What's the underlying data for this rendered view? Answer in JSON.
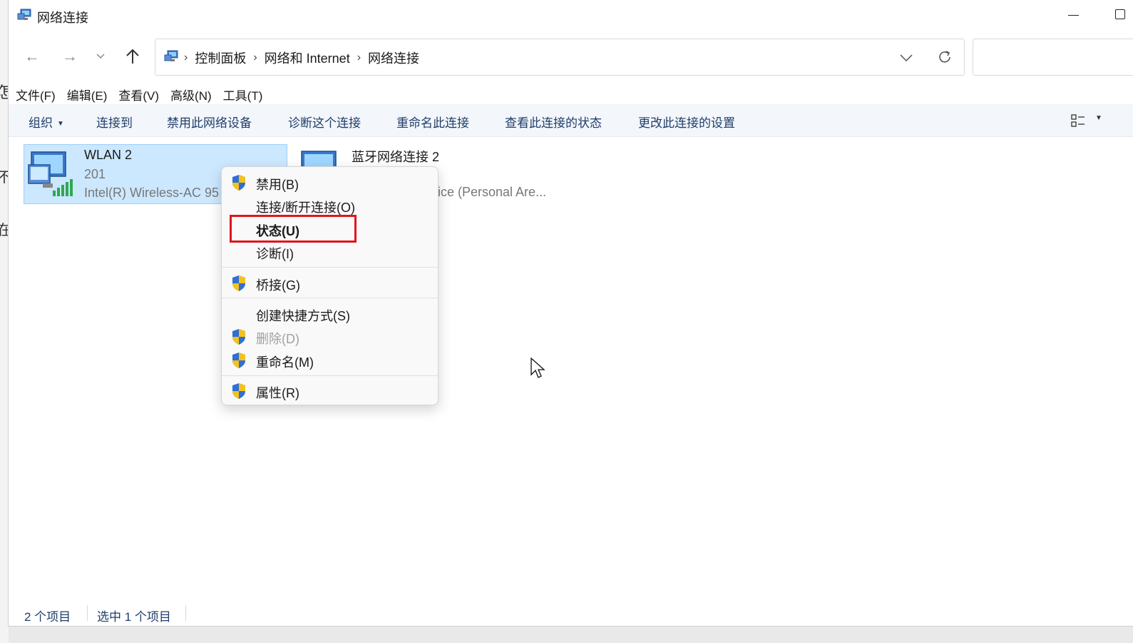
{
  "window": {
    "title": "网络连接"
  },
  "background": {
    "fragments": [
      "怎",
      "不",
      "在"
    ]
  },
  "nav": {
    "back_icon": "arrow-left-icon",
    "forward_icon": "arrow-right-icon",
    "recent_icon": "chevron-down-icon",
    "up_icon": "arrow-up-icon",
    "breadcrumbs": [
      "控制面板",
      "网络和 Internet",
      "网络连接"
    ],
    "breadcrumb_separator": "›",
    "search_placeholder": ""
  },
  "menubar": {
    "items": [
      "文件(F)",
      "编辑(E)",
      "查看(V)",
      "高级(N)",
      "工具(T)"
    ]
  },
  "commands": {
    "organize": "组织",
    "connect_to": "连接到",
    "disable_device": "禁用此网络设备",
    "diagnose": "诊断这个连接",
    "rename": "重命名此连接",
    "view_status": "查看此连接的状态",
    "change_settings": "更改此连接的设置"
  },
  "connections": [
    {
      "name": "WLAN 2",
      "line2": "201",
      "line3": "Intel(R) Wireless-AC 95",
      "selected": true
    },
    {
      "name": "蓝牙网络连接 2",
      "line2": "",
      "line3": "ice (Personal Are...",
      "selected": false
    }
  ],
  "context_menu": {
    "items": [
      {
        "label": "禁用(B)",
        "shield": true,
        "disabled": false,
        "bold": false
      },
      {
        "label": "连接/断开连接(O)",
        "shield": false,
        "disabled": false,
        "bold": false
      },
      {
        "label": "状态(U)",
        "shield": false,
        "disabled": false,
        "bold": true,
        "highlighted": true
      },
      {
        "label": "诊断(I)",
        "shield": false,
        "disabled": false,
        "bold": false
      },
      {
        "label": "桥接(G)",
        "shield": true,
        "disabled": false,
        "bold": false
      },
      {
        "label": "创建快捷方式(S)",
        "shield": false,
        "disabled": false,
        "bold": false
      },
      {
        "label": "删除(D)",
        "shield": true,
        "disabled": true,
        "bold": false
      },
      {
        "label": "重命名(M)",
        "shield": true,
        "disabled": false,
        "bold": false
      },
      {
        "label": "属性(R)",
        "shield": true,
        "disabled": false,
        "bold": false
      }
    ],
    "highlight_color": "#e0141c"
  },
  "status": {
    "item_count": "2 个项目",
    "selected_count": "选中 1 个项目"
  },
  "colors": {
    "selection_bg": "#cce8ff",
    "command_text": "#1f3d6b",
    "uac_shield_blue": "#2f6fd6",
    "uac_shield_yellow": "#f4c21a"
  }
}
